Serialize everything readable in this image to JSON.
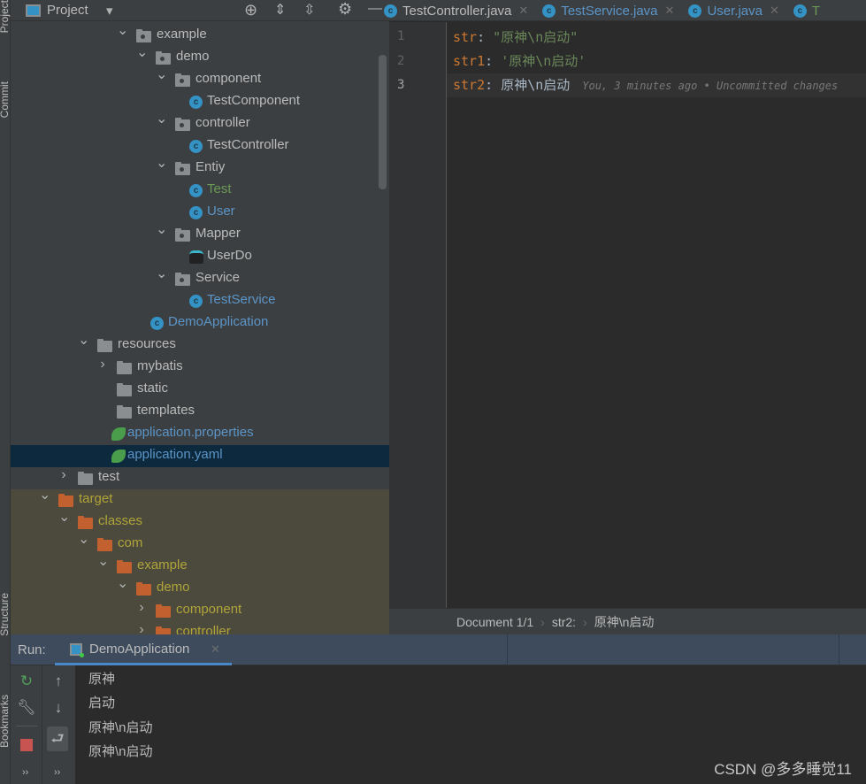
{
  "sidebar_strip": {
    "project": "Project",
    "commit": "Commit",
    "structure": "Structure",
    "bookmarks": "Bookmarks"
  },
  "project_panel": {
    "title": "Project",
    "icons": [
      "locate-icon",
      "expand-all-icon",
      "collapse-all-icon",
      "gear-icon",
      "minimize-icon"
    ],
    "tree": [
      {
        "label": "example",
        "level": 4,
        "type": "package",
        "expanded": true
      },
      {
        "label": "demo",
        "level": 5,
        "type": "package",
        "expanded": true
      },
      {
        "label": "component",
        "level": 6,
        "type": "package",
        "expanded": true
      },
      {
        "label": "TestComponent",
        "level": 7,
        "type": "class"
      },
      {
        "label": "controller",
        "level": 6,
        "type": "package",
        "expanded": true
      },
      {
        "label": "TestController",
        "level": 7,
        "type": "class"
      },
      {
        "label": "Entiy",
        "level": 6,
        "type": "package",
        "expanded": true
      },
      {
        "label": "Test",
        "level": 7,
        "type": "class",
        "color": "#6a9955"
      },
      {
        "label": "User",
        "level": 7,
        "type": "class",
        "color": "#5b95c8"
      },
      {
        "label": "Mapper",
        "level": 6,
        "type": "package",
        "expanded": true
      },
      {
        "label": "UserDo",
        "level": 7,
        "type": "mybatis"
      },
      {
        "label": "Service",
        "level": 6,
        "type": "package",
        "expanded": true
      },
      {
        "label": "TestService",
        "level": 7,
        "type": "class",
        "color": "#5b95c8"
      },
      {
        "label": "DemoApplication",
        "level": 6,
        "type": "spring-class",
        "color": "#5b95c8"
      },
      {
        "label": "resources",
        "level": 2,
        "type": "resources",
        "expanded": true
      },
      {
        "label": "mybatis",
        "level": 3,
        "type": "folder",
        "expanded": false
      },
      {
        "label": "static",
        "level": 3,
        "type": "folder"
      },
      {
        "label": "templates",
        "level": 3,
        "type": "folder"
      },
      {
        "label": "application.properties",
        "level": 3,
        "type": "spring-config",
        "color": "#5b95c8"
      },
      {
        "label": "application.yaml",
        "level": 3,
        "type": "spring-config",
        "color": "#5b95c8",
        "selected": true
      },
      {
        "label": "test",
        "level": 1,
        "type": "folder",
        "expanded": false
      },
      {
        "label": "target",
        "level": 0,
        "type": "excluded",
        "expanded": true
      },
      {
        "label": "classes",
        "level": 1,
        "type": "excluded",
        "expanded": true
      },
      {
        "label": "com",
        "level": 2,
        "type": "excluded",
        "expanded": true
      },
      {
        "label": "example",
        "level": 3,
        "type": "excluded",
        "expanded": true
      },
      {
        "label": "demo",
        "level": 4,
        "type": "excluded",
        "expanded": true
      },
      {
        "label": "component",
        "level": 5,
        "type": "excluded",
        "expanded": false
      },
      {
        "label": "controller",
        "level": 5,
        "type": "excluded",
        "expanded": false
      }
    ]
  },
  "editor": {
    "tabs": [
      {
        "label": "TestController.java",
        "color": "#bbbbbb"
      },
      {
        "label": "TestService.java",
        "color": "#5b95c8"
      },
      {
        "label": "User.java",
        "color": "#5b95c8"
      },
      {
        "label": "T",
        "color": "#6a9955"
      }
    ],
    "lines": [
      {
        "num": "1",
        "key": "str",
        "value": "\"原神\\n启动\"",
        "quoted": true
      },
      {
        "num": "2",
        "key": "str1",
        "value": "'原神\\n启动'",
        "quoted": true
      },
      {
        "num": "3",
        "key": "str2",
        "value": "原神\\n启动",
        "quoted": false,
        "hint": "You, 3 minutes ago • Uncommitted changes"
      }
    ],
    "breadcrumb": [
      "Document 1/1",
      "str2:",
      "原神\\n启动"
    ]
  },
  "run": {
    "label": "Run:",
    "tab": "DemoApplication",
    "output": [
      "原神",
      "启动",
      "原神\\n启动",
      "原神\\n启动"
    ],
    "more1": "››",
    "more2": "››"
  },
  "watermark": "CSDN @多多睡觉11",
  "colors": {
    "target_text": "#b0a43a",
    "target_folder": "#c2602f",
    "package_folder": "#8a8e91",
    "class_icon": "#3592c4"
  }
}
